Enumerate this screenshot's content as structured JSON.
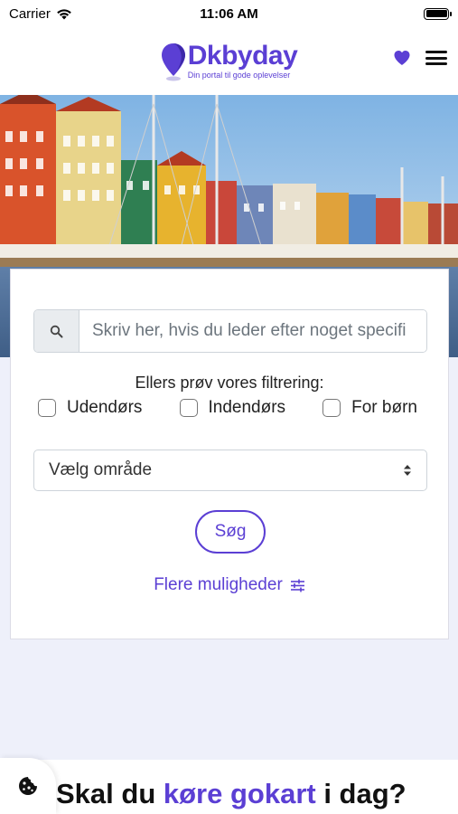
{
  "status_bar": {
    "carrier": "Carrier",
    "time": "11:06 AM"
  },
  "header": {
    "logo_name": "Dkbyday",
    "logo_tagline": "Din portal til gode oplevelser",
    "brand_color": "#5b3fd4",
    "icons": [
      "heart-icon",
      "hamburger-menu-icon"
    ]
  },
  "search": {
    "placeholder": "Skriv her, hvis du leder efter noget specifi",
    "filter_caption": "Ellers prøv vores filtrering:",
    "filters": [
      {
        "label": "Udendørs",
        "checked": false
      },
      {
        "label": "Indendørs",
        "checked": false
      },
      {
        "label": "For børn",
        "checked": false
      }
    ],
    "area_select": "Vælg område",
    "submit_label": "Søg",
    "more_options_label": "Flere muligheder"
  },
  "promo": {
    "prefix": "Skal du ",
    "highlight": "køre gokart",
    "suffix": " i dag?"
  }
}
